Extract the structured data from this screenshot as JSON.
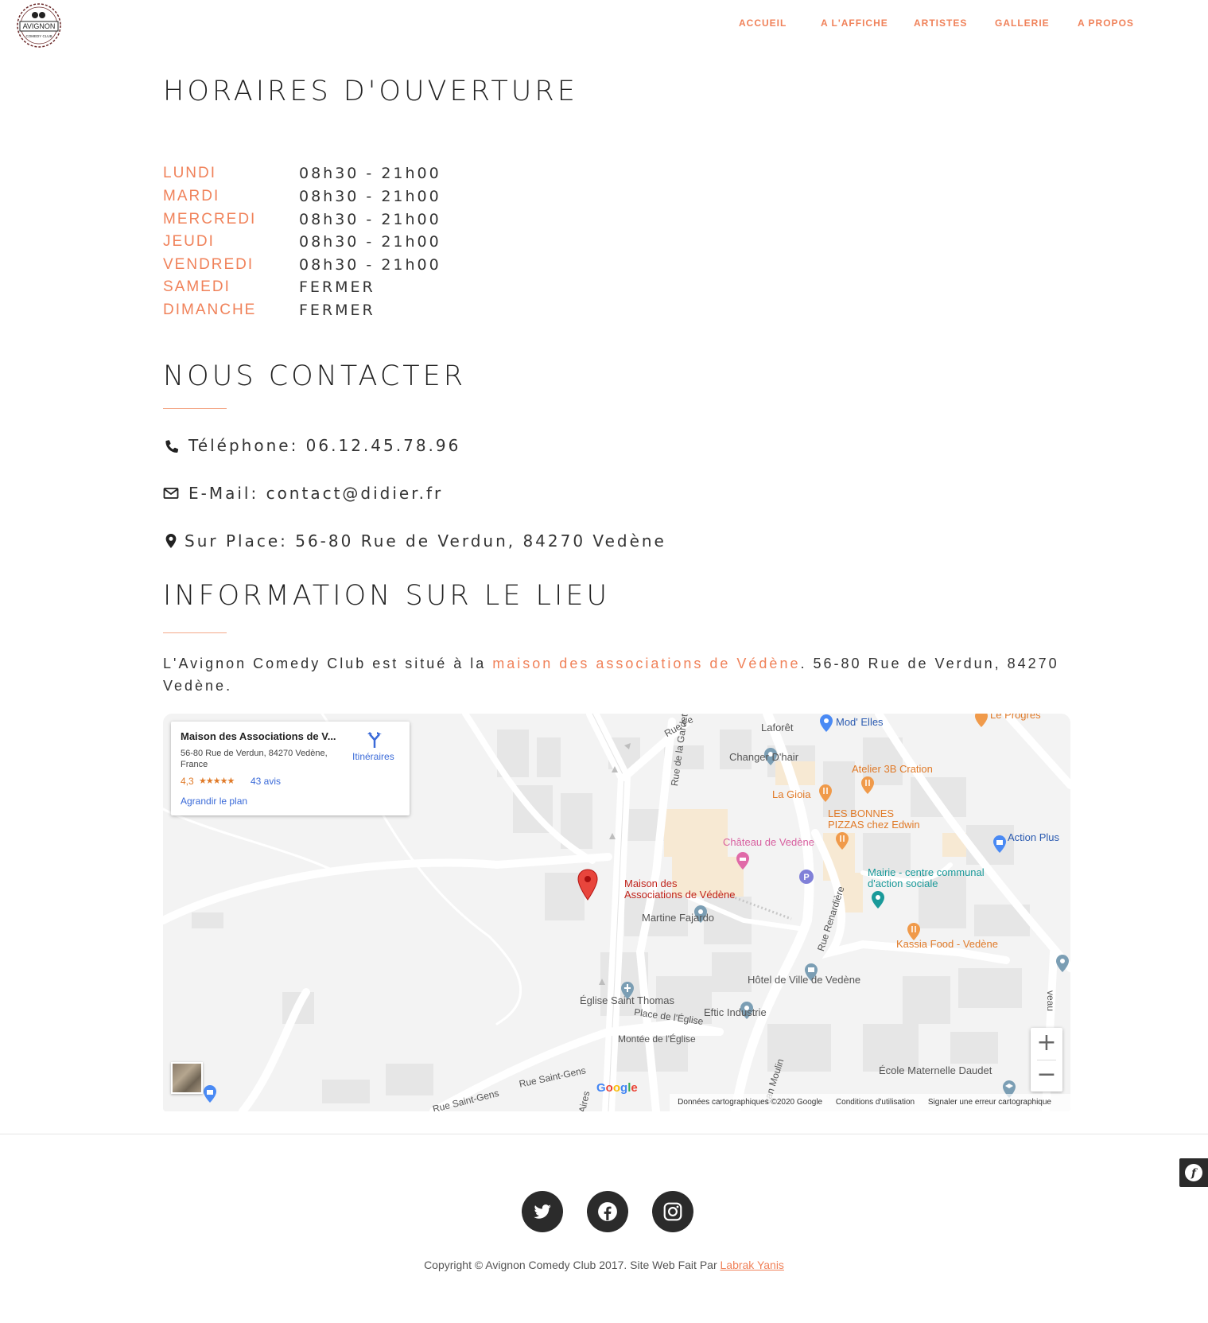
{
  "brand": {
    "logo_top_text": "AVIGNON",
    "logo_bottom_text": "COMEDY CLUB"
  },
  "nav": {
    "items": [
      {
        "label": "ACCUEIL"
      },
      {
        "label": "A L'AFFICHE"
      },
      {
        "label": "ARTISTES"
      },
      {
        "label": "GALLERIE"
      },
      {
        "label": "A PROPOS"
      }
    ]
  },
  "hours": {
    "title": "HORAIRES D'OUVERTURE",
    "rows": [
      {
        "day": "LUNDI",
        "time": "08h30 - 21h00"
      },
      {
        "day": "MARDI",
        "time": "08h30 - 21h00"
      },
      {
        "day": "MERCREDI",
        "time": "08h30 - 21h00"
      },
      {
        "day": "JEUDI",
        "time": "08h30 - 21h00"
      },
      {
        "day": "VENDREDI",
        "time": "08h30 - 21h00"
      },
      {
        "day": "SAMEDI",
        "time": "FERMER"
      },
      {
        "day": "DIMANCHE",
        "time": "FERMER"
      }
    ]
  },
  "contact": {
    "title": "NOUS CONTACTER",
    "phone": "Téléphone: 06.12.45.78.96",
    "email": "E-Mail: contact@didier.fr",
    "place": "Sur Place: 56-80 Rue de Verdun, 84270 Vedène",
    "icons": [
      "phone-icon",
      "envelope-icon",
      "map-marker-icon"
    ]
  },
  "venue": {
    "title": "INFORMATION SUR LE LIEU",
    "text_before": "L'Avignon Comedy Club est situé à la ",
    "link": "maison des associations de Védène",
    "text_after": ". 56-80 Rue de Verdun, 84270 Vedène."
  },
  "map": {
    "card": {
      "title": "Maison des Associations de V...",
      "address": "56-80 Rue de Verdun, 84270 Vedène, France",
      "rating": "4,3",
      "stars": "★★★★★",
      "reviews": "43 avis",
      "enlarge": "Agrandir le plan",
      "directions": "Itinéraires"
    },
    "labels": {
      "laforet": "Laforêt",
      "mod_elles": "Mod' Elles",
      "le_progres": "Le Progrès",
      "changer_dhair": "Changer D'hair",
      "atelier": "Atelier 3B Cration",
      "la_gioia": "La Gioia",
      "pizzas_1": "LES BONNES",
      "pizzas_2": "PIZZAS chez Edwin",
      "chateau": "Château de Vedène",
      "action_plus": "Action Plus",
      "mairie_1": "Mairie - centre communal",
      "mairie_2": "d'action sociale",
      "maison_1": "Maison des",
      "maison_2": "Associations de Védène",
      "martine": "Martine Fajardo",
      "kassia": "Kassia Food - Vedène",
      "hotel_ville": "Hôtel de Ville de Vedène",
      "eglise": "Église Saint Thomas",
      "place_eglise": "Place de l'Église",
      "eftic": "Eftic Industrie",
      "montee": "Montée de l'Église",
      "ecole": "École Maternelle Daudet",
      "rue_gardette": "Rue de la Gardette",
      "rue_renardiere": "Rue Renardière",
      "rue_saint_gens_1": "Rue Saint-Gens",
      "rue_saint_gens_2": "Rue Saint-Gens",
      "aires": "Aires",
      "jean_moulin": "ean Moulin",
      "rue_fe": "Rue Fe",
      "veau": "veau",
      "google": "Google"
    },
    "attribution": {
      "data": "Données cartographiques ©2020 Google",
      "terms": "Conditions d'utilisation",
      "report": "Signaler une erreur cartographique"
    },
    "zoom_in": "+",
    "zoom_out": "−"
  },
  "footer": {
    "social": [
      "twitter-icon",
      "facebook-icon",
      "instagram-icon"
    ],
    "copyright": "Copyright © Avignon Comedy Club 2017. Site Web Fait Par ",
    "author": "Labrak Yanis"
  },
  "colors": {
    "accent": "#f0825a",
    "text": "#333333",
    "footer_icon_bg": "#2b2b2b"
  }
}
